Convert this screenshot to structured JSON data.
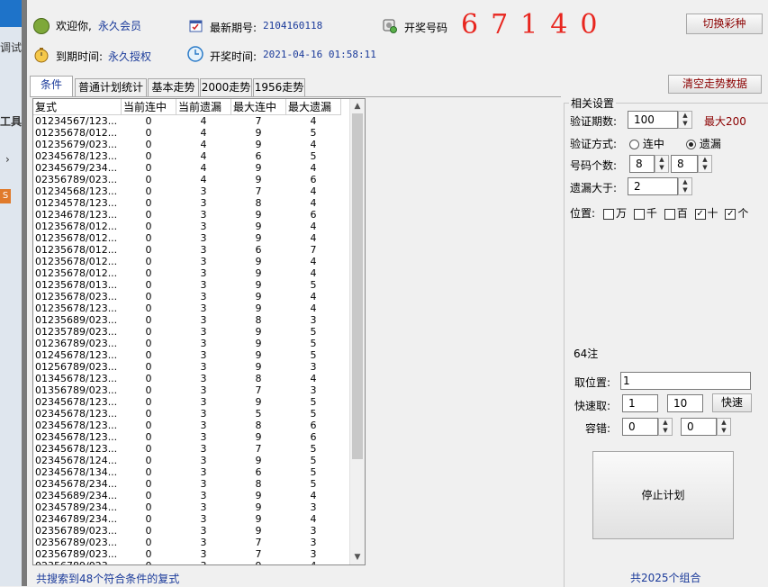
{
  "left_strip": {
    "t1": "调试",
    "t2": "工具",
    "s_btn": "S"
  },
  "header": {
    "welcome_label": "欢迎你,",
    "welcome_value": "永久会员",
    "latest_issue_label": "最新期号:",
    "latest_issue_value": "2104160118",
    "draw_number_label": "开奖号码",
    "draw_numbers": "67140",
    "switch_button": "切换彩种",
    "expire_label": "到期时间:",
    "expire_value": "永久授权",
    "draw_time_label": "开奖时间:",
    "draw_time_value": "2021-04-16 01:58:11"
  },
  "tabs": [
    "条件",
    "普通计划统计",
    "基本走势",
    "2000走势",
    "1956走势"
  ],
  "clear_button": "清空走势数据",
  "table": {
    "headers": [
      "复式",
      "当前连中",
      "当前遗漏",
      "最大连中",
      "最大遗漏"
    ],
    "rows": [
      [
        "01234567/123...",
        "0",
        "4",
        "7",
        "4"
      ],
      [
        "01235678/012...",
        "0",
        "4",
        "9",
        "5"
      ],
      [
        "01235679/023...",
        "0",
        "4",
        "9",
        "4"
      ],
      [
        "02345678/123...",
        "0",
        "4",
        "6",
        "5"
      ],
      [
        "02345679/234...",
        "0",
        "4",
        "9",
        "4"
      ],
      [
        "02356789/023...",
        "0",
        "4",
        "9",
        "6"
      ],
      [
        "01234568/123...",
        "0",
        "3",
        "7",
        "4"
      ],
      [
        "01234578/123...",
        "0",
        "3",
        "8",
        "4"
      ],
      [
        "01234678/123...",
        "0",
        "3",
        "9",
        "6"
      ],
      [
        "01235678/012...",
        "0",
        "3",
        "9",
        "4"
      ],
      [
        "01235678/012...",
        "0",
        "3",
        "9",
        "4"
      ],
      [
        "01235678/012...",
        "0",
        "3",
        "6",
        "7"
      ],
      [
        "01235678/012...",
        "0",
        "3",
        "9",
        "4"
      ],
      [
        "01235678/012...",
        "0",
        "3",
        "9",
        "4"
      ],
      [
        "01235678/013...",
        "0",
        "3",
        "9",
        "5"
      ],
      [
        "01235678/023...",
        "0",
        "3",
        "9",
        "4"
      ],
      [
        "01235678/123...",
        "0",
        "3",
        "9",
        "4"
      ],
      [
        "01235689/023...",
        "0",
        "3",
        "8",
        "3"
      ],
      [
        "01235789/023...",
        "0",
        "3",
        "9",
        "5"
      ],
      [
        "01236789/023...",
        "0",
        "3",
        "9",
        "5"
      ],
      [
        "01245678/123...",
        "0",
        "3",
        "9",
        "5"
      ],
      [
        "01256789/023...",
        "0",
        "3",
        "9",
        "3"
      ],
      [
        "01345678/123...",
        "0",
        "3",
        "8",
        "4"
      ],
      [
        "01356789/023...",
        "0",
        "3",
        "7",
        "3"
      ],
      [
        "02345678/123...",
        "0",
        "3",
        "9",
        "5"
      ],
      [
        "02345678/123...",
        "0",
        "3",
        "5",
        "5"
      ],
      [
        "02345678/123...",
        "0",
        "3",
        "8",
        "6"
      ],
      [
        "02345678/123...",
        "0",
        "3",
        "9",
        "6"
      ],
      [
        "02345678/123...",
        "0",
        "3",
        "7",
        "5"
      ],
      [
        "02345678/124...",
        "0",
        "3",
        "9",
        "5"
      ],
      [
        "02345678/134...",
        "0",
        "3",
        "6",
        "5"
      ],
      [
        "02345678/234...",
        "0",
        "3",
        "8",
        "5"
      ],
      [
        "02345689/234...",
        "0",
        "3",
        "9",
        "4"
      ],
      [
        "02345789/234...",
        "0",
        "3",
        "9",
        "3"
      ],
      [
        "02346789/234...",
        "0",
        "3",
        "9",
        "4"
      ],
      [
        "02356789/023...",
        "0",
        "3",
        "9",
        "3"
      ],
      [
        "02356789/023...",
        "0",
        "3",
        "7",
        "3"
      ],
      [
        "02356789/023...",
        "0",
        "3",
        "7",
        "3"
      ],
      [
        "02356789/023...",
        "0",
        "3",
        "9",
        "4"
      ]
    ]
  },
  "status_left": "共搜索到48个符合条件的复式",
  "settings": {
    "group_title": "相关设置",
    "verify_periods_label": "验证期数:",
    "verify_periods_value": "100",
    "max_note": "最大200",
    "verify_mode_label": "验证方式:",
    "mode_option1": "连中",
    "mode_option2": "遗漏",
    "mode_selected": "遗漏",
    "count_label": "号码个数:",
    "count_value1": "8",
    "count_value2": "8",
    "miss_gt_label": "遗漏大于:",
    "miss_gt_value": "2",
    "position_label": "位置:",
    "positions": [
      {
        "label": "万",
        "checked": false
      },
      {
        "label": "千",
        "checked": false
      },
      {
        "label": "百",
        "checked": false
      },
      {
        "label": "十",
        "checked": true
      },
      {
        "label": "个",
        "checked": true
      }
    ],
    "count_notes": "64注",
    "take_position_label": "取位置:",
    "take_position_value": "1",
    "quick_take_label": "快速取:",
    "quick_from": "1",
    "quick_to": "10",
    "quick_button": "快速",
    "tolerance_label": "容错:",
    "tolerance_value1": "0",
    "tolerance_value2": "0",
    "stop_button": "停止计划",
    "status_right": "共2025个组合"
  }
}
